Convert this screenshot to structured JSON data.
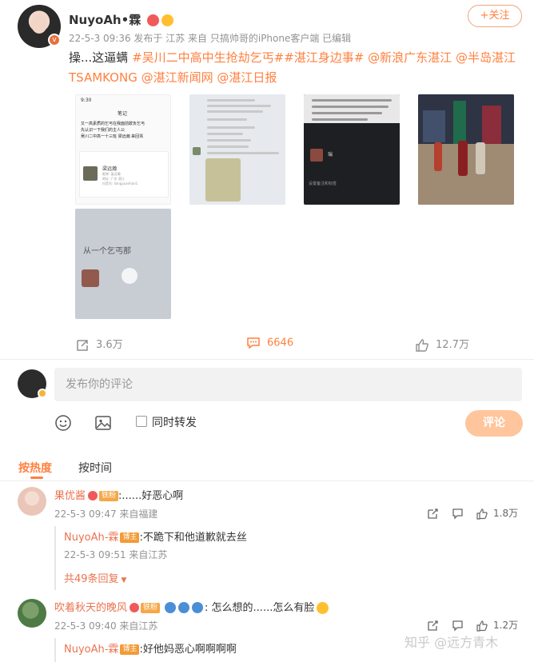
{
  "post": {
    "username": "NuyoAh•霖",
    "meta": "22-5-3 09:36  发布于 江苏  来自 只搞帅哥的iPhone客户端  已编辑",
    "follow_label": "+关注",
    "text_prefix": "操...这逼螨 ",
    "tags": [
      "#吴川二中高中生抢劫乞丐#",
      "#湛江身边事#",
      "@新浪广东湛江",
      "@半岛湛江TSAMKONG",
      "@湛江新闻网",
      "@湛江日报"
    ],
    "img1": {
      "status": "9:30",
      "title": "笔记",
      "lines": [
        "又一高素质的乞丐在我面前欺负乞丐",
        "先认识一下我们的主人公",
        "吴川二中高一十三班 梁远瀚 来回骂"
      ],
      "profile_name": "梁远瀚",
      "profile_sub": [
        "昵称: 梁远瀚",
        "地址: 广东 湛江",
        "抖音号: liangyuanhan1"
      ]
    },
    "img3": {
      "name": "瑞",
      "label": "设置备注和标签"
    },
    "img5": {
      "text": "从一个乞丐那"
    }
  },
  "actions": {
    "repost_count": "3.6万",
    "comment_count": "6646",
    "like_count": "12.7万"
  },
  "composer": {
    "placeholder": "发布你的评论",
    "repost_label": "同时转发",
    "submit_label": "评论"
  },
  "sort": {
    "hot": "按热度",
    "time": "按时间"
  },
  "comments": [
    {
      "name": "果优酱",
      "badge": "铁粉",
      "text": ":......好恶心啊",
      "time": "22-5-3 09:47  来自福建",
      "likes": "1.8万",
      "reply": {
        "name": "NuyoAh-霖",
        "badge": "博主",
        "text": ":不跪下和他道歉就去丝",
        "time": "22-5-3 09:51  来自江苏"
      },
      "more": "共49条回复"
    },
    {
      "name": "吹着秋天的晚风",
      "badge": "铁粉",
      "text": ": 怎么想的......怎么有脸",
      "time": "22-5-3 09:40  来自江苏",
      "likes": "1.2万",
      "reply": {
        "name": "NuyoAh-霖",
        "badge": "博主",
        "text": ":好他妈恶心啊啊啊啊"
      }
    }
  ],
  "watermark": "知乎 @远方青木",
  "colors": {
    "accent": "#ff8140",
    "name": "#eb7350",
    "meta": "#939393"
  }
}
